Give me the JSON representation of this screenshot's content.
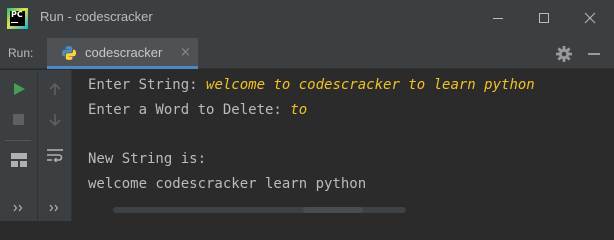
{
  "window": {
    "title": "Run - codescracker",
    "logo_text": "PC"
  },
  "runbar": {
    "label": "Run:",
    "tab_label": "codescracker",
    "tab_close": "×"
  },
  "console": {
    "prompt1": "Enter String: ",
    "input1": "welcome to codescracker to learn python",
    "prompt2": "Enter a Word to Delete: ",
    "input2": "to",
    "output_label": "New String is:",
    "output_value": "welcome codescracker learn python"
  },
  "colors": {
    "accent": "#4a88c7",
    "input_text": "#f0c227",
    "run_green": "#499c54",
    "console_bg": "#2b2b2b"
  }
}
